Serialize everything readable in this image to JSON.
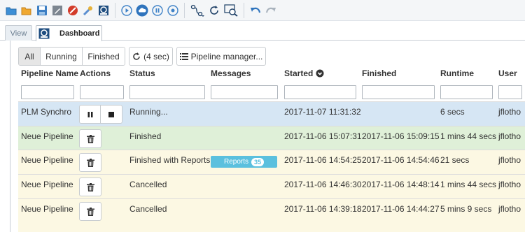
{
  "toolbar": {
    "icons": [
      "folder-icon",
      "open-folder-icon",
      "save-icon",
      "edit-icon",
      "stop-icon",
      "tools-icon",
      "dashboard-icon",
      "play-icon",
      "cloud-icon",
      "pause-icon",
      "record-icon",
      "connect-icon",
      "refresh-icon",
      "search-icon",
      "undo-icon",
      "redo-icon"
    ]
  },
  "tabs": {
    "view": "View",
    "dashboard": "Dashboard"
  },
  "filters": {
    "all": "All",
    "running": "Running",
    "finished": "Finished",
    "refresh": "(4 sec)",
    "pipeline_manager": "Pipeline manager..."
  },
  "columns": {
    "name": "Pipeline Name",
    "actions": "Actions",
    "status": "Status",
    "messages": "Messages",
    "started": "Started",
    "finished": "Finished",
    "runtime": "Runtime",
    "user": "User"
  },
  "rows": [
    {
      "name": "PLM Synchro",
      "status": "Running...",
      "messages": "",
      "started": "2017-11-07 11:31:32",
      "finished": "",
      "runtime": "6 secs",
      "user": "jflotho",
      "state": "running",
      "bg": "#d6e6f4"
    },
    {
      "name": "Neue Pipeline",
      "status": "Finished",
      "messages": "",
      "started": "2017-11-06 15:07:31",
      "finished": "2017-11-06 15:09:15",
      "runtime": "1 mins 44 secs",
      "user": "jflotho",
      "state": "finished",
      "bg": "#dff0d8"
    },
    {
      "name": "Neue Pipeline",
      "status": "Finished with Reports",
      "messages": "Reports",
      "report_count": "35",
      "started": "2017-11-06 14:54:25",
      "finished": "2017-11-06 14:54:46",
      "runtime": "21 secs",
      "user": "jflotho",
      "state": "reports",
      "bg": "#fcf8e3"
    },
    {
      "name": "Neue Pipeline",
      "status": "Cancelled",
      "messages": "",
      "started": "2017-11-06 14:46:30",
      "finished": "2017-11-06 14:48:14",
      "runtime": "1 mins 44 secs",
      "user": "jflotho",
      "state": "cancelled",
      "bg": "#fcf8e3"
    },
    {
      "name": "Neue Pipeline",
      "status": "Cancelled",
      "messages": "",
      "started": "2017-11-06 14:39:18",
      "finished": "2017-11-06 14:44:27",
      "runtime": "5 mins 9 secs",
      "user": "jflotho",
      "state": "cancelled",
      "bg": "#fcf8e3"
    }
  ]
}
